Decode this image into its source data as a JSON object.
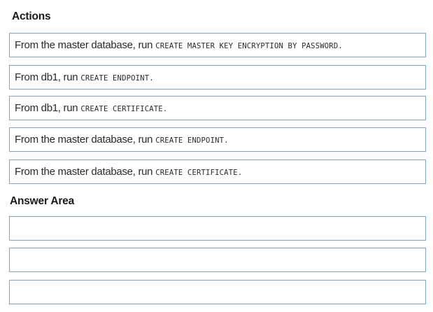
{
  "actions": {
    "title": "Actions",
    "items": [
      {
        "prefix": "From the master database, run",
        "code": "CREATE MASTER KEY ENCRYPTION BY PASSWORD."
      },
      {
        "prefix": "From db1, run",
        "code": "CREATE ENDPOINT."
      },
      {
        "prefix": "From db1, run",
        "code": "CREATE CERTIFICATE."
      },
      {
        "prefix": "From the master database, run",
        "code": "CREATE ENDPOINT."
      },
      {
        "prefix": "From the master database, run",
        "code": "CREATE CERTIFICATE."
      }
    ]
  },
  "answer_area": {
    "title": "Answer Area",
    "slots": 3
  }
}
